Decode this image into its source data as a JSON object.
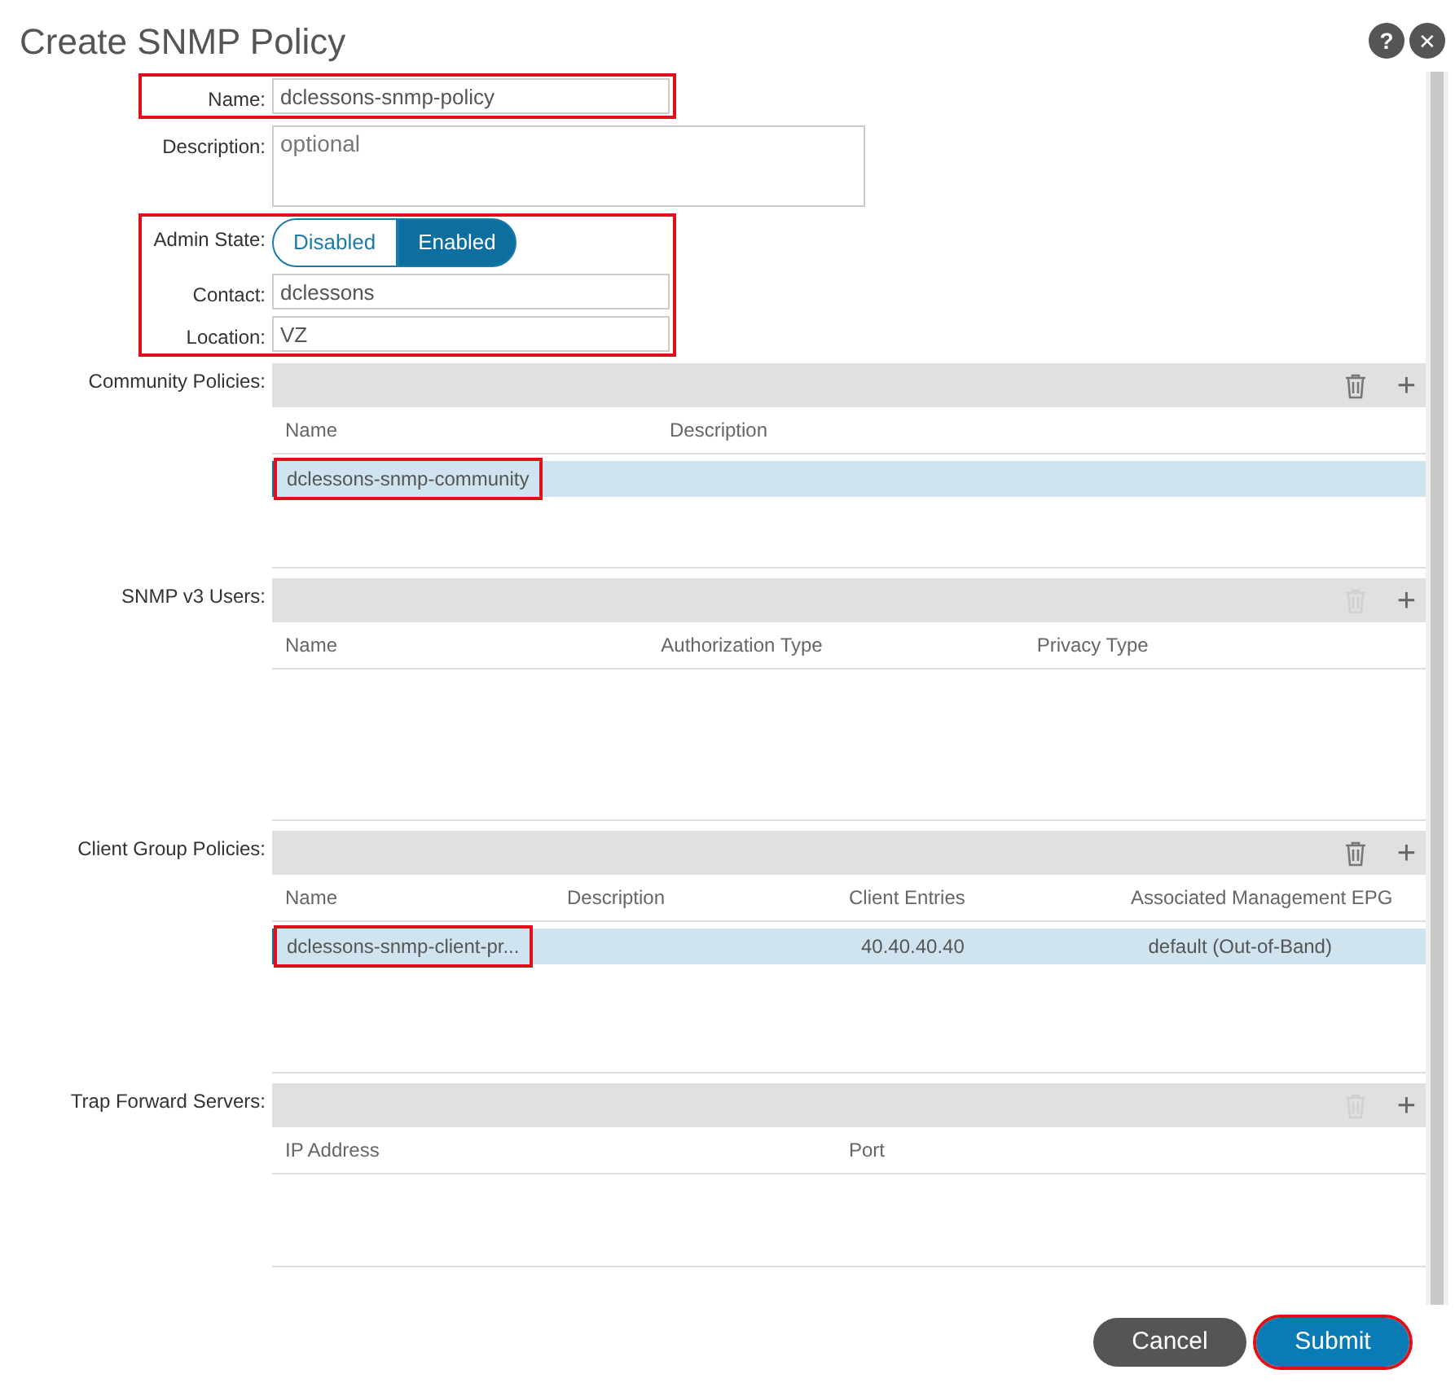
{
  "dialog": {
    "title": "Create SNMP Policy",
    "help": "?",
    "close": "✕"
  },
  "field_groups": [
    {
      "highlighted": true,
      "fields": [
        {
          "kind": "text",
          "label": "Name:",
          "value": "dclessons-snmp-policy"
        }
      ]
    },
    {
      "highlighted": false,
      "fields": [
        {
          "kind": "textarea",
          "label": "Description:",
          "placeholder": "optional"
        }
      ]
    },
    {
      "highlighted": true,
      "fields": [
        {
          "kind": "toggle",
          "label": "Admin State:",
          "options": [
            {
              "label": "Disabled",
              "selected": false
            },
            {
              "label": "Enabled",
              "selected": true
            }
          ]
        },
        {
          "kind": "text",
          "label": "Contact:",
          "value": "dclessons"
        },
        {
          "kind": "text",
          "label": "Location:",
          "value": "VZ"
        }
      ]
    }
  ],
  "tables": [
    {
      "label": "Community Policies:",
      "delete_disabled": false,
      "add": "+",
      "columns": [
        "Name",
        "Description"
      ],
      "rows": [
        {
          "cells": [
            "dclessons-snmp-community",
            ""
          ],
          "selected": true,
          "highlighted": true
        }
      ]
    },
    {
      "label": "SNMP v3 Users:",
      "delete_disabled": true,
      "add": "+",
      "columns": [
        "Name",
        "Authorization Type",
        "Privacy Type"
      ]
    },
    {
      "label": "Client Group Policies:",
      "delete_disabled": false,
      "add": "+",
      "columns": [
        "Name",
        "Description",
        "Client Entries",
        "Associated Management EPG"
      ],
      "rows": [
        {
          "cells": [
            "dclessons-snmp-client-pr...",
            "",
            "40.40.40.40",
            "default (Out-of-Band)"
          ],
          "selected": true,
          "highlighted": true
        }
      ]
    },
    {
      "label": "Trap Forward Servers:",
      "delete_disabled": true,
      "add": "+",
      "columns": [
        "IP Address",
        "Port"
      ]
    }
  ],
  "buttons": [
    {
      "kind": "secondary",
      "label": "Cancel",
      "highlighted": false
    },
    {
      "kind": "primary",
      "label": "Submit",
      "highlighted": true
    }
  ]
}
